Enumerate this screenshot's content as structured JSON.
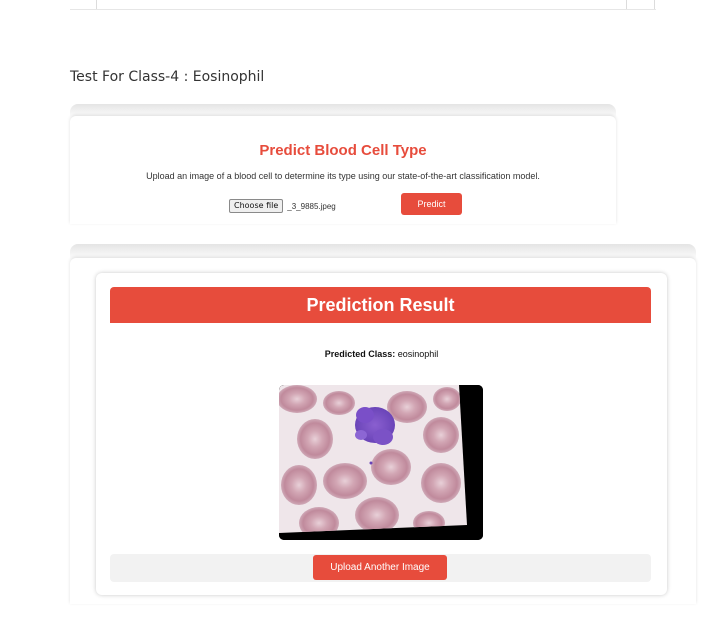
{
  "section": {
    "heading": "Test For Class-4 : Eosinophil"
  },
  "upload": {
    "title": "Predict Blood Cell Type",
    "description": "Upload an image of a blood cell to determine its type using our state-of-the-art classification model.",
    "choose_file_label": "Choose file",
    "file_name": "_3_9885.jpeg",
    "predict_label": "Predict"
  },
  "result": {
    "title": "Prediction Result",
    "predicted_label": "Predicted Class:",
    "predicted_value": "eosinophil",
    "image_alt": "blood cell microscopy image",
    "upload_another_label": "Upload Another Image"
  },
  "colors": {
    "accent": "#e74c3c",
    "bar_background": "#f2f2f2"
  }
}
